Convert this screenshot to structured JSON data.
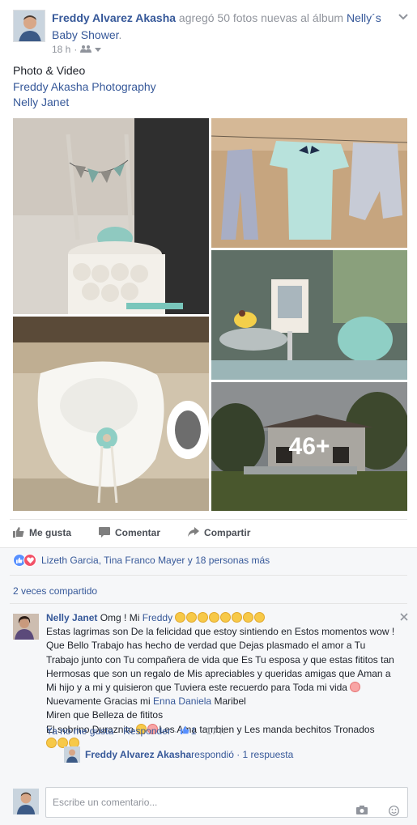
{
  "post": {
    "author": "Freddy Alvarez Akasha",
    "action_text": " agregó 50 fotos nuevas al álbum ",
    "album": "Nelly´s Baby Shower",
    "album_suffix": ".",
    "time": "18 h",
    "audience_icon": "friends-icon",
    "menu_icon": "chevron-down-icon"
  },
  "caption": {
    "line1": "Photo & Video",
    "line2": "Freddy Akasha Photography",
    "line3": "Nelly Janet"
  },
  "photos": {
    "more_count": "46+"
  },
  "actions": {
    "like": "Me gusta",
    "comment": "Comentar",
    "share": "Compartir"
  },
  "reactions": {
    "text": "Lizeth Garcia, Tina Franco Mayer y 18 personas más",
    "icons": [
      "like-icon",
      "love-icon"
    ]
  },
  "shares": "2 veces compartido",
  "comment": {
    "author": "Nelly Janet",
    "text_start": " Omg ! Mi ",
    "mention1": "Freddy",
    "line2": "Estas lagrimas son De la felicidad que estoy sintiendo en Estos momentos wow !",
    "line3": "Que Bello Trabajo has hecho de verdad que Dejas plasmado el amor a Tu",
    "line4": "Trabajo junto con Tu compañera de vida que Es Tu esposa y que estas fititos tan",
    "line5": "Hermosas que son un regalo de Mis apreciables y queridas amigas que Aman a",
    "line6": "Mi hijo y a mi y quisieron que Tuviera este recuerdo para Toda mi vida",
    "line7_start": "Nuevamente Gracias mi ",
    "mention2": "Enna Daniela",
    "line7_end": " Maribel",
    "line8": "Miren que Belleza de fititos",
    "line9_start": "El sobrino Duraznito",
    "line9_end": "Les Ama tambien y Les manda bechitos Tronados",
    "like_link": "Ya no me gusta",
    "reply_link": "Responder",
    "like_count": "1",
    "time": "17 h",
    "close_icon": "close-icon"
  },
  "reply_summary": {
    "author": "Freddy Alvarez Akasha",
    "text": " respondió · 1 respuesta"
  },
  "compose": {
    "placeholder": "Escribe un comentario..."
  },
  "colors": {
    "link": "#365899",
    "muted": "#90949c",
    "text": "#1d2129",
    "like_blue": "#5890ff",
    "love_red": "#f25268"
  }
}
